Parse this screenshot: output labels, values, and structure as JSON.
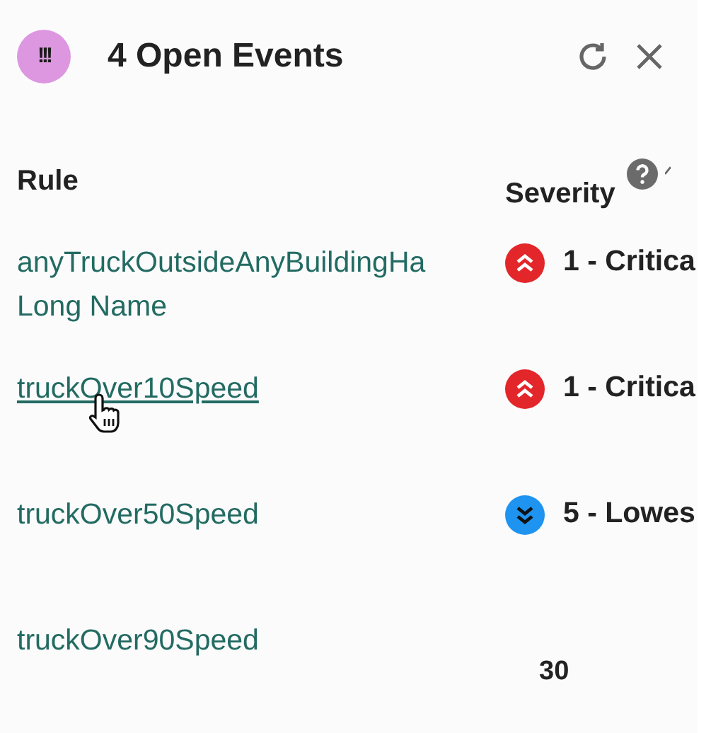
{
  "header": {
    "badge": "!!!",
    "title": "4 Open Events"
  },
  "columns": [
    {
      "label": "Rule"
    },
    {
      "label": "Severity"
    }
  ],
  "rows": [
    {
      "rule": [
        "anyTruckOutsideAnyBuildingHa",
        "Long Name"
      ],
      "hovered": false,
      "severity": {
        "kind": "critical",
        "label": "1 - Critica"
      }
    },
    {
      "rule": [
        "truckOver10Speed"
      ],
      "hovered": true,
      "severity": {
        "kind": "critical",
        "label": "1 - Critica"
      }
    },
    {
      "rule": [
        "truckOver50Speed"
      ],
      "hovered": false,
      "severity": {
        "kind": "lowest",
        "label": "5 - Lowes"
      }
    },
    {
      "rule": [
        "truckOver90Speed"
      ],
      "hovered": false,
      "count": "30"
    }
  ]
}
